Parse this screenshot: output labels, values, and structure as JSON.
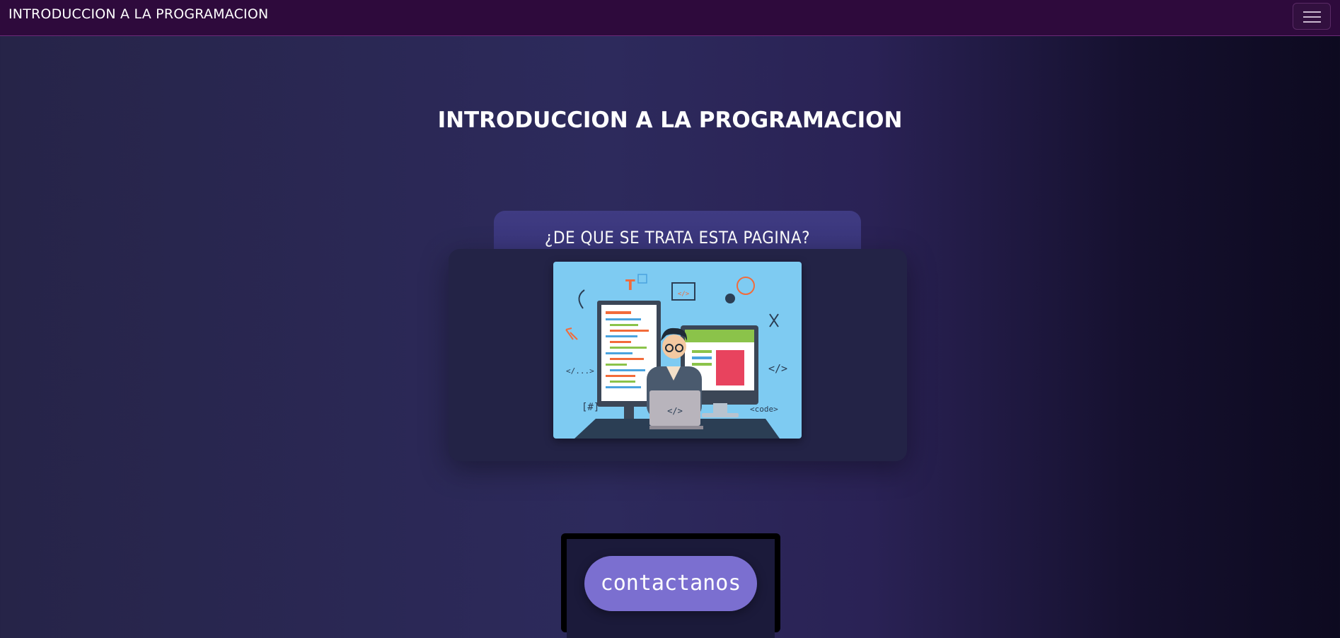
{
  "navbar": {
    "brand": "INTRODUCCION A LA PROGRAMACION",
    "toggler_icon": "hamburger-menu-icon"
  },
  "main": {
    "heading": "INTRODUCCION A LA PROGRAMACION",
    "card": {
      "title": "¿DE QUE SE TRATA ESTA PAGINA?",
      "illustration": {
        "name": "programmer-at-computer-illustration",
        "glyphs": [
          "T",
          "</>",
          "</...>",
          "[#]",
          "<code>"
        ]
      }
    },
    "contact_button": "contactanos"
  },
  "colors": {
    "navbar_bg": "#2e0a3c",
    "page_bg": "#2d2a5c",
    "card_tab_bg": "#3f3b82",
    "card_bg": "#232346",
    "button_bg": "#7b6fd0",
    "illustration_bg": "#7ecbf2"
  }
}
